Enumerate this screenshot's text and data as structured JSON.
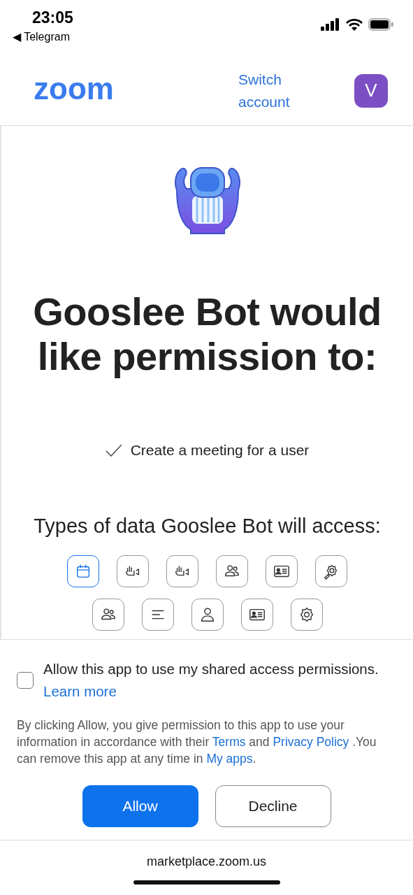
{
  "status_bar": {
    "time": "23:05",
    "back_app": "◀ Telegram"
  },
  "header": {
    "logo": "zoom",
    "switch_account": "Switch account",
    "avatar": "V"
  },
  "title": "Gooslee Bot would like permission to:",
  "permissions": [
    {
      "text": "Create a meeting for a user",
      "checked": true
    }
  ],
  "data_heading": "Types of data Gooslee Bot will access:",
  "data_types": [
    {
      "kind": "calendar",
      "selected": true
    },
    {
      "kind": "video",
      "selected": false
    },
    {
      "kind": "video",
      "selected": false
    },
    {
      "kind": "people",
      "selected": false
    },
    {
      "kind": "card",
      "selected": false
    },
    {
      "kind": "gear-pen",
      "selected": false
    },
    {
      "kind": "people",
      "selected": false
    },
    {
      "kind": "lines",
      "selected": false
    },
    {
      "kind": "person",
      "selected": false
    },
    {
      "kind": "card",
      "selected": false
    },
    {
      "kind": "gear",
      "selected": false
    }
  ],
  "shared_access": {
    "checked": false,
    "label": "Allow this app to use my shared access permissions.",
    "link": "Learn more"
  },
  "consent": {
    "text_1": "By clicking Allow, you give permission to this app to use your information in accordance with their",
    "terms": "Terms",
    "and": "and",
    "privacy": "Privacy Policy",
    "text_2": ".You can remove this app at any time in",
    "my_apps": "My apps",
    "end": "."
  },
  "buttons": [
    {
      "label": "Allow",
      "kind": "primary"
    },
    {
      "label": "Decline",
      "kind": "secondary"
    }
  ],
  "address_bar": {
    "url": "marketplace.zoom.us"
  }
}
